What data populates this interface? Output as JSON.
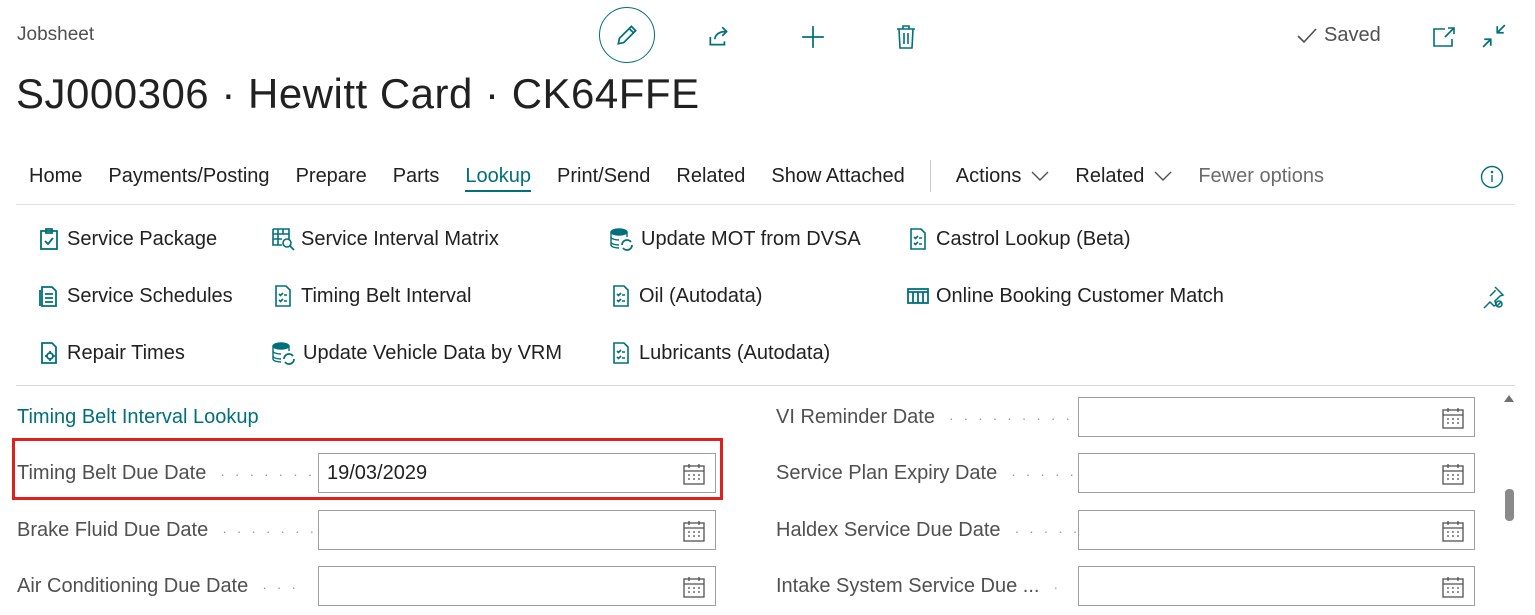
{
  "header": {
    "breadcrumb": "Jobsheet",
    "title": "SJ000306 · Hewitt Card · CK64FFE",
    "saved_label": "Saved"
  },
  "menu": {
    "items": [
      "Home",
      "Payments/Posting",
      "Prepare",
      "Parts",
      "Lookup",
      "Print/Send",
      "Related",
      "Show Attached"
    ],
    "active": "Lookup",
    "dropdowns": [
      "Actions",
      "Related"
    ],
    "fewer_options": "Fewer options"
  },
  "actions": {
    "col1": [
      "Service Package",
      "Service Schedules",
      "Repair Times"
    ],
    "col2": [
      "Service Interval Matrix",
      "Timing Belt Interval",
      "Update Vehicle Data by VRM"
    ],
    "col3": [
      "Update MOT from DVSA",
      "Oil (Autodata)",
      "Lubricants (Autodata)"
    ],
    "col4": [
      "Castrol Lookup (Beta)",
      "Online Booking Customer Match"
    ]
  },
  "form": {
    "section_title": "Timing Belt Interval Lookup",
    "left_fields": [
      {
        "label": "Timing Belt Due Date",
        "value": "19/03/2029"
      },
      {
        "label": "Brake Fluid Due Date",
        "value": ""
      },
      {
        "label": "Air Conditioning Due Date",
        "value": ""
      }
    ],
    "right_fields": [
      {
        "label": "VI Reminder Date",
        "value": ""
      },
      {
        "label": "Service Plan Expiry Date",
        "value": ""
      },
      {
        "label": "Haldex Service Due Date",
        "value": ""
      },
      {
        "label": "Intake System Service Due ...",
        "value": ""
      }
    ]
  },
  "colors": {
    "accent": "#00707a",
    "highlight": "#e0201c"
  }
}
